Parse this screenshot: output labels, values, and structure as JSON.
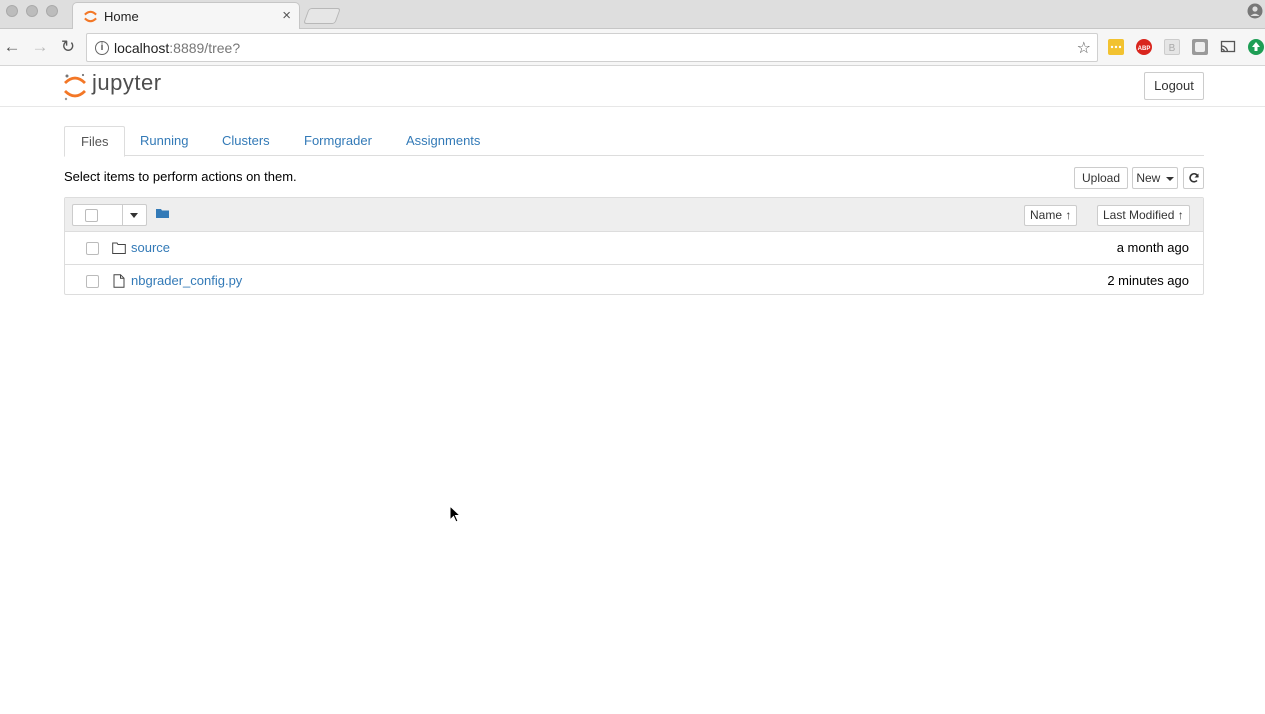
{
  "browser": {
    "tab_title": "Home",
    "tab_close": "×",
    "url_host": "localhost",
    "url_path": ":8889/tree?",
    "info_glyph": "i",
    "star_glyph": "☆",
    "back_glyph": "←",
    "forward_glyph": "→",
    "reload_glyph": "↻",
    "extensions": [
      {
        "name": "notes-extension",
        "color": "#f2c230"
      },
      {
        "name": "adblock-extension",
        "color": "#d9251d",
        "text": "ABP"
      },
      {
        "name": "b-extension",
        "color": "#d0d0d0"
      },
      {
        "name": "window-extension",
        "color": "#9a9a9a"
      },
      {
        "name": "cast-extension",
        "color": "#666666"
      },
      {
        "name": "update-extension",
        "color": "#1e9e55"
      }
    ]
  },
  "header": {
    "logo_text": "jupyter",
    "logout_label": "Logout"
  },
  "tabs": [
    {
      "label": "Files",
      "active": true
    },
    {
      "label": "Running",
      "active": false
    },
    {
      "label": "Clusters",
      "active": false
    },
    {
      "label": "Formgrader",
      "active": false
    },
    {
      "label": "Assignments",
      "active": false
    }
  ],
  "toolbar": {
    "hint": "Select items to perform actions on them.",
    "upload_label": "Upload",
    "new_label": "New",
    "refresh_glyph": "⟳"
  },
  "listing": {
    "sort_name_label": "Name",
    "sort_modified_label": "Last Modified",
    "sort_arrow": "🡑",
    "items": [
      {
        "name": "source",
        "type": "folder",
        "modified": "a month ago"
      },
      {
        "name": "nbgrader_config.py",
        "type": "file",
        "modified": "2 minutes ago"
      }
    ]
  },
  "colors": {
    "link": "#337ab7",
    "jupyter_orange": "#f37726"
  }
}
